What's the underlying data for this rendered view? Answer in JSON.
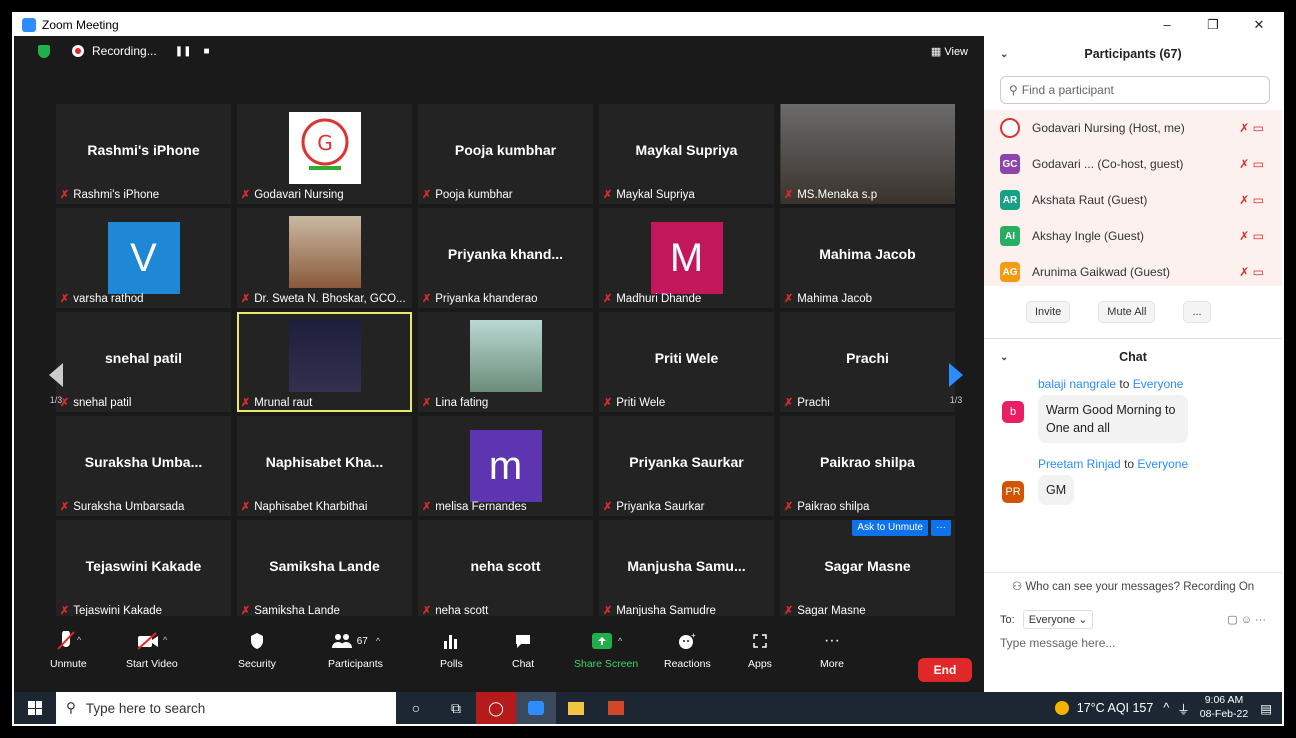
{
  "window": {
    "title": "Zoom Meeting",
    "min": "–",
    "restore": "❐",
    "close": "✕"
  },
  "topbar": {
    "recording_label": "Recording...",
    "pause": "❚❚",
    "stop": "■",
    "view_label": "▦ View"
  },
  "tiles": [
    {
      "big": "Rashmi's iPhone",
      "name": "Rashmi's iPhone"
    },
    {
      "big": "",
      "name": "Godavari Nursing",
      "photo": "logo"
    },
    {
      "big": "Pooja kumbhar",
      "name": "Pooja kumbhar"
    },
    {
      "big": "Maykal Supriya",
      "name": "Maykal Supriya"
    },
    {
      "big": "",
      "name": "MS.Menaka s.p",
      "photo": "room"
    },
    {
      "big": "",
      "name": "varsha rathod",
      "avatar": "V",
      "avatar_color": "#1e88d6"
    },
    {
      "big": "",
      "name": "Dr. Sweta N. Bhoskar, GCO...",
      "photo": "person"
    },
    {
      "big": "Priyanka khand...",
      "name": "Priyanka khanderao"
    },
    {
      "big": "",
      "name": "Madhuri Dhande",
      "avatar": "M",
      "avatar_color": "#c2185b"
    },
    {
      "big": "Mahima Jacob",
      "name": "Mahima Jacob"
    },
    {
      "big": "snehal patil",
      "name": "snehal patil"
    },
    {
      "big": "",
      "name": "Mrunal raut",
      "photo": "dark",
      "highlight": true
    },
    {
      "big": "",
      "name": "Lina fating",
      "photo": "portrait"
    },
    {
      "big": "Priti Wele",
      "name": "Priti Wele"
    },
    {
      "big": "Prachi",
      "name": "Prachi"
    },
    {
      "big": "Suraksha  Umba...",
      "name": "Suraksha  Umbarsada"
    },
    {
      "big": "Naphisabet  Kha...",
      "name": "Naphisabet Kharbithai"
    },
    {
      "big": "",
      "name": "melisa Fernandes",
      "avatar": "m",
      "avatar_color": "#5e35b1"
    },
    {
      "big": "Priyanka Saurkar",
      "name": "Priyanka Saurkar"
    },
    {
      "big": "Paikrao shilpa",
      "name": "Paikrao shilpa"
    },
    {
      "big": "Tejaswini Kakade",
      "name": "Tejaswini Kakade"
    },
    {
      "big": "Samiksha Lande",
      "name": "Samiksha Lande"
    },
    {
      "big": "neha scott",
      "name": "neha scott"
    },
    {
      "big": "Manjusha  Samu...",
      "name": "Manjusha Samudre"
    },
    {
      "big": "Sagar Masne",
      "name": "Sagar Masne",
      "ask": true
    }
  ],
  "ask_to_unmute": "Ask to Unmute",
  "ask_more": "···",
  "page_indicator": "1/3",
  "toolbar": {
    "unmute": "Unmute",
    "start_video": "Start Video",
    "security": "Security",
    "participants": "Participants",
    "participants_count": "67",
    "polls": "Polls",
    "chat": "Chat",
    "share_screen": "Share Screen",
    "reactions": "Reactions",
    "apps": "Apps",
    "more": "More",
    "end": "End"
  },
  "panel": {
    "participants_title": "Participants (67)",
    "search_placeholder": "Find a participant",
    "participants": [
      {
        "initials": "",
        "name": "Godavari Nursing (Host, me)",
        "color": "#ffffff"
      },
      {
        "initials": "GC",
        "name": "Godavari ...  (Co-host, guest)",
        "color": "#8e44ad"
      },
      {
        "initials": "AR",
        "name": "Akshata Raut (Guest)",
        "color": "#16a085"
      },
      {
        "initials": "AI",
        "name": "Akshay Ingle (Guest)",
        "color": "#27ae60"
      },
      {
        "initials": "AG",
        "name": "Arunima Gaikwad (Guest)",
        "color": "#f39c12"
      }
    ],
    "invite": "Invite",
    "mute_all": "Mute All",
    "more": "...",
    "chat_title": "Chat",
    "messages": [
      {
        "sender": "balaji nangrale",
        "to": "to",
        "target": "Everyone",
        "initial": "b",
        "color": "#e91e63",
        "text": "Warm Good Morning to One and all"
      },
      {
        "sender": "Preetam Rinjad",
        "to": "to",
        "target": "Everyone",
        "initial": "PR",
        "color": "#d35400",
        "text": "GM"
      }
    ],
    "notice": "Who can see your messages? Recording On",
    "to_label": "To:",
    "to_value": "Everyone ⌄",
    "message_placeholder": "Type message here..."
  },
  "taskbar": {
    "search": "Type here to search",
    "weather": "17°C  AQI 157",
    "time": "9:06 AM",
    "date": "08-Feb-22"
  }
}
